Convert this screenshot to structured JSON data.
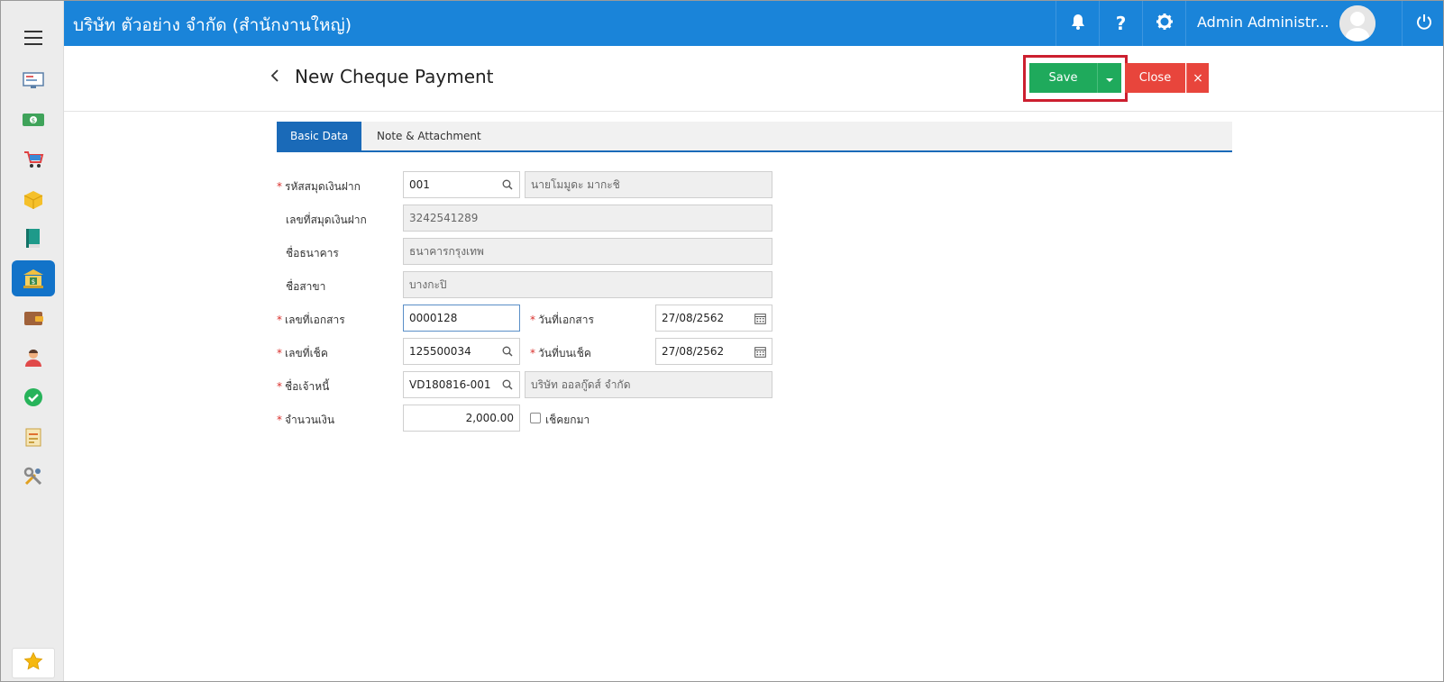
{
  "app": {
    "company": "บริษัท ตัวอย่าง จำกัด (สำนักงานใหญ่)",
    "user_name": "Admin Administr...",
    "colors": {
      "topbar": "#1a84d9",
      "save": "#1faa5c",
      "close": "#e8453c",
      "tab_active": "#1a6ab8",
      "highlight": "#cc1f2f"
    }
  },
  "sidebar": {
    "items": [
      {
        "icon": "dashboard-icon"
      },
      {
        "icon": "money-icon"
      },
      {
        "icon": "cart-icon"
      },
      {
        "icon": "box-icon"
      },
      {
        "icon": "book-icon"
      },
      {
        "icon": "bank-icon",
        "active": true
      },
      {
        "icon": "wallet-icon"
      },
      {
        "icon": "people-icon"
      },
      {
        "icon": "check-circle-icon"
      },
      {
        "icon": "report-icon"
      },
      {
        "icon": "tools-icon"
      }
    ],
    "favorite_icon": "star-icon"
  },
  "header": {
    "title": "New Cheque Payment",
    "save_label": "Save",
    "close_label": "Close",
    "close_x": "×"
  },
  "tabs": [
    {
      "label": "Basic Data",
      "active": true
    },
    {
      "label": "Note & Attachment",
      "active": false
    }
  ],
  "form": {
    "bank_book_code": {
      "label": "รหัสสมุดเงินฝาก",
      "required": true,
      "value": "001",
      "name": "นายโมมูดะ มากะชิ"
    },
    "bank_book_no": {
      "label": "เลขที่สมุดเงินฝาก",
      "value": "3242541289"
    },
    "bank_name": {
      "label": "ชื่อธนาคาร",
      "value": "ธนาคารกรุงเทพ"
    },
    "branch_name": {
      "label": "ชื่อสาขา",
      "value": "บางกะปิ"
    },
    "doc_no": {
      "label": "เลขที่เอกสาร",
      "required": true,
      "value": "0000128"
    },
    "doc_date": {
      "label": "วันที่เอกสาร",
      "required": true,
      "value": "27/08/2562"
    },
    "cheque_no": {
      "label": "เลขที่เช็ค",
      "required": true,
      "value": "125500034"
    },
    "cheque_date": {
      "label": "วันที่บนเช็ค",
      "required": true,
      "value": "27/08/2562"
    },
    "creditor": {
      "label": "ชื่อเจ้าหนี้",
      "required": true,
      "value": "VD180816-001",
      "name": "บริษัท ออลกู๊ดส์ จำกัด"
    },
    "amount": {
      "label": "จำนวนเงิน",
      "required": true,
      "value": "2,000.00"
    },
    "forward_cheque": {
      "label": "เช็คยกมา",
      "checked": false
    }
  }
}
